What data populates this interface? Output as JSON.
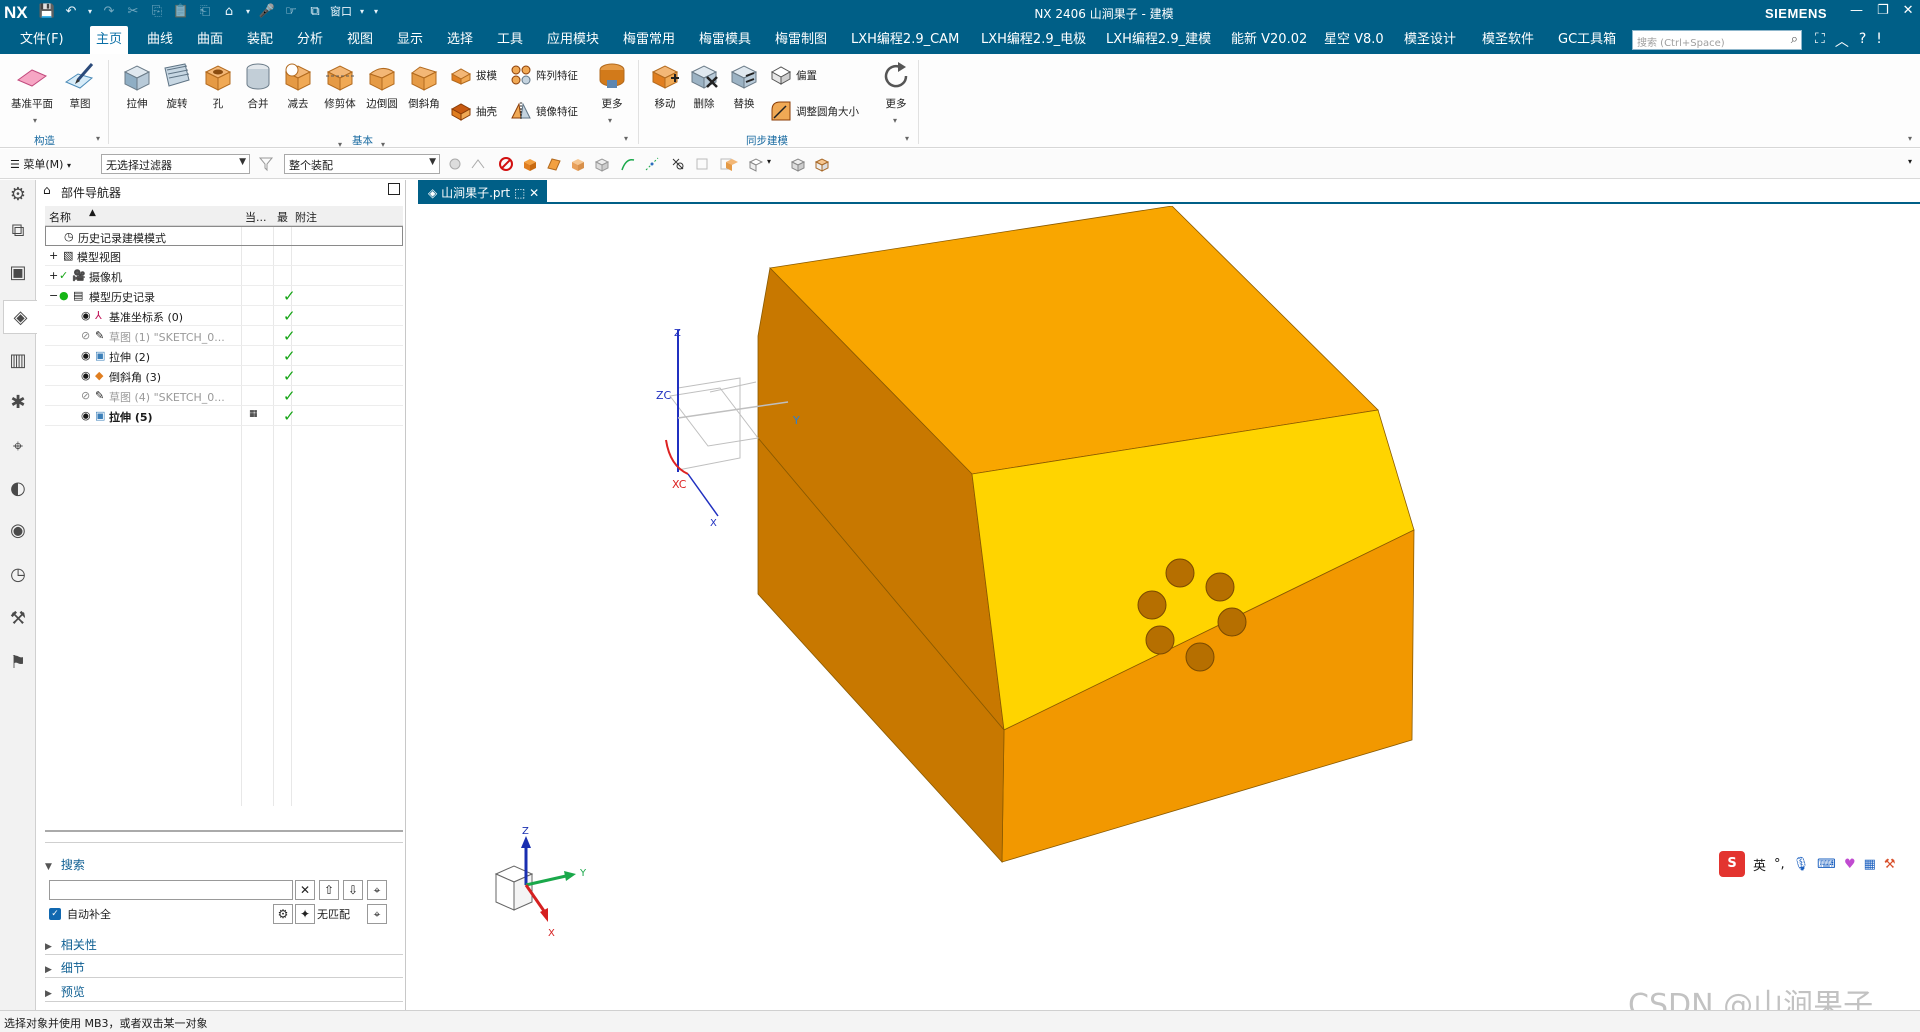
{
  "title_bar": {
    "logo": "NX",
    "title": "NX 2406 山涧果子 - 建模",
    "window_menu": "窗口",
    "brand": "SIEMENS",
    "controls": [
      "—",
      "❐",
      "✕"
    ]
  },
  "menu": {
    "items": [
      "文件(F)",
      "主页",
      "曲线",
      "曲面",
      "装配",
      "分析",
      "视图",
      "显示",
      "选择",
      "工具",
      "应用模块",
      "梅雷常用",
      "梅雷模具",
      "梅雷制图",
      "LXH编程2.9_CAM",
      "LXH编程2.9_电极",
      "LXH编程2.9_建模",
      "能新 V20.02",
      "星空 V8.0",
      "模圣设计",
      "模圣软件",
      "GC工具箱"
    ],
    "active_index": 1,
    "search_placeholder": "搜索 (Ctrl+Space)"
  },
  "ribbon": {
    "construct": {
      "datum_plane": "基准平面",
      "sketch": "草图",
      "group_label": "构造"
    },
    "basic": {
      "extrude": "拉伸",
      "revolve": "旋转",
      "hole": "孔",
      "unite": "合并",
      "subtract": "减去",
      "trim_body": "修剪体",
      "edge_blend": "边倒圆",
      "chamfer": "倒斜角",
      "draft": "拔模",
      "shell": "抽壳",
      "pattern_feature": "阵列特征",
      "mirror_feature": "镜像特征",
      "more": "更多",
      "group_label": "基本"
    },
    "sync": {
      "move": "移动",
      "delete": "删除",
      "replace": "替换",
      "offset": "偏置",
      "resize_blend": "调整圆角大小",
      "more": "更多",
      "group_label": "同步建模"
    }
  },
  "selection_bar": {
    "menu": "菜单(M)",
    "type_filter": "无选择过滤器",
    "scope": "整个装配"
  },
  "navigator": {
    "title": "部件导航器",
    "columns": [
      "名称",
      "当...",
      "最",
      "附注"
    ],
    "rows": [
      {
        "label": "历史记录建模模式",
        "level": 0,
        "check": ""
      },
      {
        "label": "模型视图",
        "level": 0,
        "check": ""
      },
      {
        "label": "摄像机",
        "level": 0,
        "check": ""
      },
      {
        "label": "模型历史记录",
        "level": 0,
        "check": "✓"
      },
      {
        "label": "基准坐标系 (0)",
        "level": 1,
        "check": "✓"
      },
      {
        "label": "草图 (1) \"SKETCH_0...",
        "level": 1,
        "check": "✓"
      },
      {
        "label": "拉伸 (2)",
        "level": 1,
        "check": "✓"
      },
      {
        "label": "倒斜角 (3)",
        "level": 1,
        "check": "✓"
      },
      {
        "label": "草图 (4) \"SKETCH_0...",
        "level": 1,
        "check": "✓"
      },
      {
        "label": "拉伸 (5)",
        "level": 1,
        "check": "✓"
      }
    ],
    "search": {
      "label": "搜索",
      "auto_complete": "自动补全",
      "no_match": "无匹配"
    },
    "sections": [
      "相关性",
      "细节",
      "预览"
    ]
  },
  "document_tab": "山涧果子.prt",
  "viewport": {
    "colors": {
      "top": "#f9a600",
      "front": "#ffd400",
      "side": "#c87800",
      "bottom_front": "#f29800",
      "hole": "#b66f00"
    },
    "datum_labels": {
      "z": "Z",
      "zc": "ZC",
      "y": "Y",
      "xc": "XC",
      "x": "X"
    },
    "triad_labels": {
      "z": "Z",
      "y": "Y",
      "x": "X"
    }
  },
  "ime_bar": {
    "mode": "英"
  },
  "status": "选择对象并使用 MB3，或者双击某一对象",
  "watermark": "CSDN @山涧果子"
}
